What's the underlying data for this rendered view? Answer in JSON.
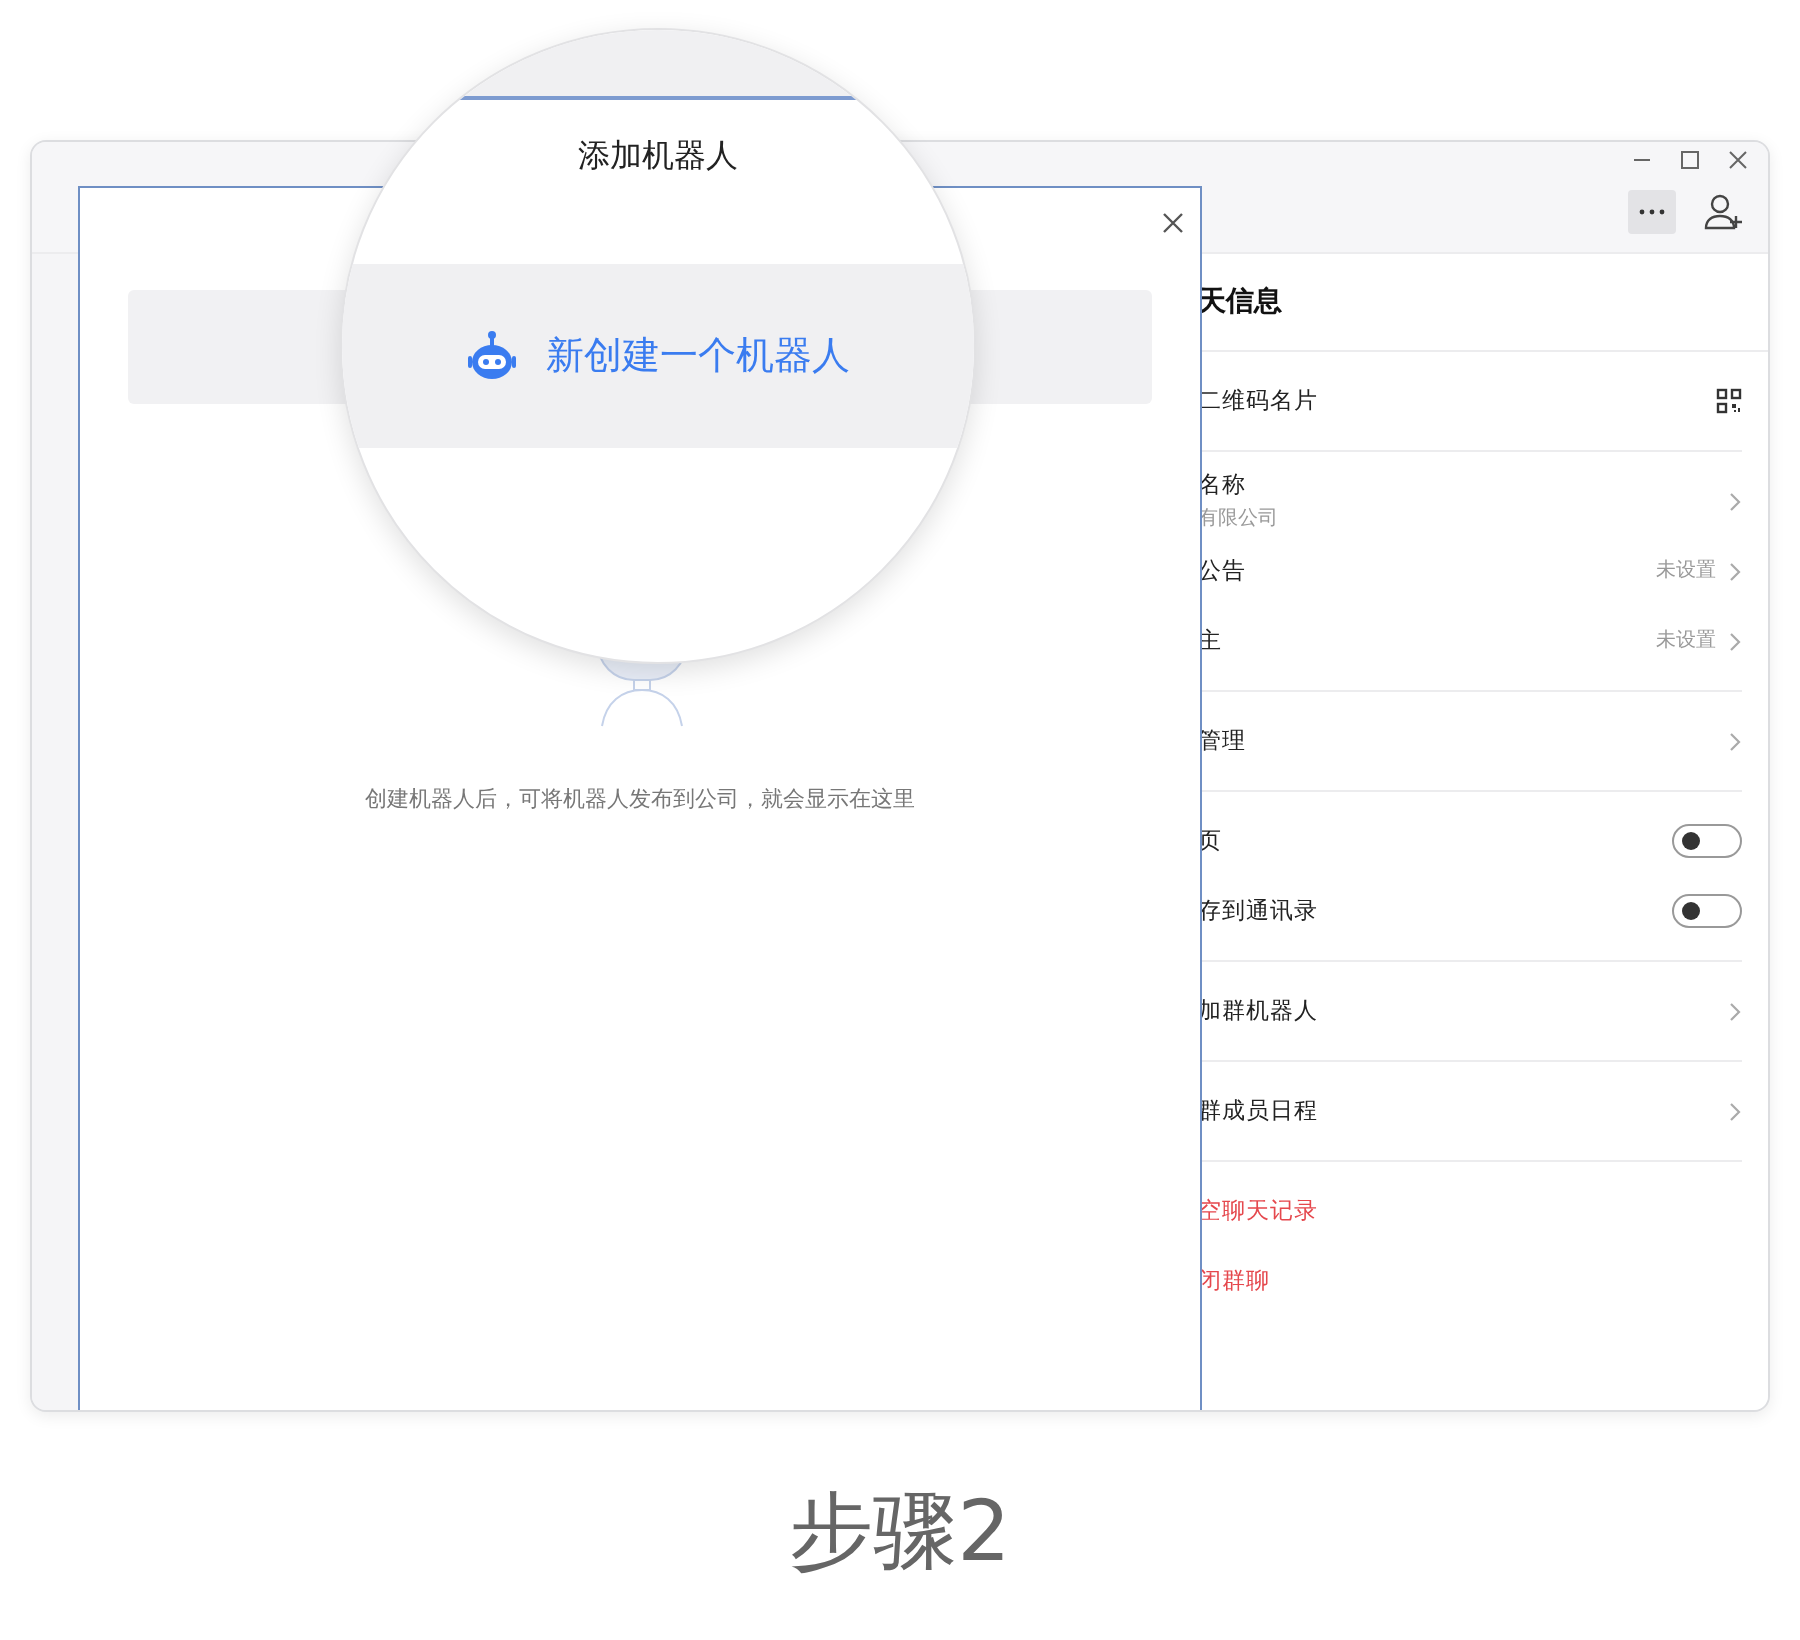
{
  "info_panel": {
    "title": "天信息",
    "sections": [
      [
        {
          "kind": "qr",
          "label": "二维码名片"
        }
      ],
      [
        {
          "kind": "link",
          "label": "名称",
          "subtitle": "有限公司"
        },
        {
          "kind": "link",
          "label": "公告",
          "value": "未设置"
        },
        {
          "kind": "link",
          "label": "主",
          "value": "未设置"
        }
      ],
      [
        {
          "kind": "link",
          "label": "管理"
        }
      ],
      [
        {
          "kind": "toggle",
          "label": "页",
          "on": false
        },
        {
          "kind": "toggle",
          "label": "存到通讯录",
          "on": false
        }
      ],
      [
        {
          "kind": "link",
          "label": "加群机器人"
        }
      ],
      [
        {
          "kind": "link",
          "label": "群成员日程"
        }
      ],
      [
        {
          "kind": "danger",
          "label": "空聊天记录"
        },
        {
          "kind": "danger",
          "label": "闭群聊"
        }
      ]
    ]
  },
  "dialog": {
    "title": "添加机器人",
    "create_button": "新创建一个机器人",
    "empty_hint": "创建机器人后，可将机器人发布到公司，就会显示在这里"
  },
  "caption": "步骤2"
}
